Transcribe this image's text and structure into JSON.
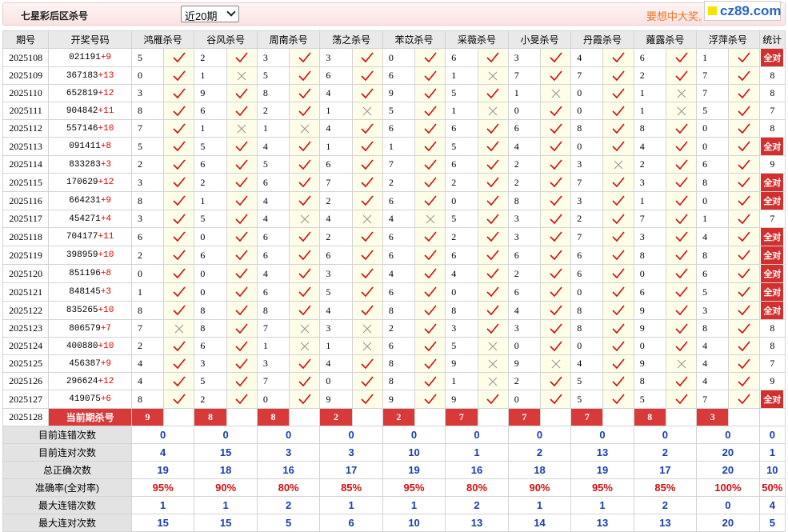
{
  "header": {
    "title": "七星彩后区杀号",
    "select_value": "近20期",
    "promo": "要想中大奖,",
    "logo": "cz89.com"
  },
  "columns": {
    "period": "期号",
    "draw": "开奖号码",
    "experts": [
      "鸿雁杀号",
      "谷风杀号",
      "周南杀号",
      "荡之杀号",
      "苯苡杀号",
      "采薇杀号",
      "小旻杀号",
      "丹霞杀号",
      "蕹露杀号",
      "浮萍杀号"
    ],
    "stat": "统计"
  },
  "full_label": "全对",
  "rows": [
    {
      "p": "2025108",
      "d": "021191",
      "b": "+9",
      "k": [
        5,
        2,
        3,
        3,
        0,
        6,
        3,
        4,
        6,
        1
      ],
      "r": [
        1,
        1,
        1,
        1,
        1,
        1,
        1,
        1,
        1,
        1
      ],
      "s": "全对"
    },
    {
      "p": "2025109",
      "d": "367183",
      "b": "+13",
      "k": [
        0,
        1,
        5,
        6,
        6,
        1,
        7,
        7,
        2,
        7
      ],
      "r": [
        1,
        0,
        1,
        1,
        1,
        0,
        1,
        1,
        1,
        1
      ],
      "s": "8"
    },
    {
      "p": "2025110",
      "d": "652819",
      "b": "+12",
      "k": [
        3,
        9,
        8,
        4,
        9,
        5,
        1,
        0,
        1,
        7
      ],
      "r": [
        1,
        1,
        1,
        1,
        1,
        1,
        0,
        1,
        0,
        1
      ],
      "s": "8"
    },
    {
      "p": "2025111",
      "d": "904842",
      "b": "+11",
      "k": [
        8,
        6,
        2,
        1,
        5,
        1,
        0,
        0,
        1,
        5
      ],
      "r": [
        1,
        1,
        1,
        0,
        1,
        0,
        1,
        1,
        0,
        1
      ],
      "s": "7"
    },
    {
      "p": "2025112",
      "d": "557146",
      "b": "+10",
      "k": [
        7,
        1,
        1,
        4,
        6,
        6,
        6,
        8,
        8,
        0
      ],
      "r": [
        1,
        0,
        0,
        1,
        1,
        1,
        1,
        1,
        1,
        1
      ],
      "s": "8"
    },
    {
      "p": "2025113",
      "d": "091411",
      "b": "+8",
      "k": [
        5,
        5,
        4,
        1,
        1,
        5,
        4,
        0,
        4,
        0
      ],
      "r": [
        1,
        1,
        1,
        1,
        1,
        1,
        1,
        1,
        1,
        1
      ],
      "s": "全对"
    },
    {
      "p": "2025114",
      "d": "833283",
      "b": "+3",
      "k": [
        2,
        6,
        5,
        6,
        7,
        6,
        2,
        3,
        2,
        6
      ],
      "r": [
        1,
        1,
        1,
        1,
        1,
        1,
        1,
        0,
        1,
        1
      ],
      "s": "9"
    },
    {
      "p": "2025115",
      "d": "170629",
      "b": "+12",
      "k": [
        3,
        2,
        6,
        7,
        2,
        2,
        2,
        7,
        3,
        8
      ],
      "r": [
        1,
        1,
        1,
        1,
        1,
        1,
        1,
        1,
        1,
        1
      ],
      "s": "全对"
    },
    {
      "p": "2025116",
      "d": "664231",
      "b": "+9",
      "k": [
        8,
        1,
        4,
        2,
        6,
        0,
        8,
        3,
        1,
        0
      ],
      "r": [
        1,
        1,
        1,
        1,
        1,
        1,
        1,
        1,
        1,
        1
      ],
      "s": "全对"
    },
    {
      "p": "2025117",
      "d": "454271",
      "b": "+4",
      "k": [
        3,
        5,
        4,
        4,
        4,
        5,
        3,
        2,
        7,
        1
      ],
      "r": [
        1,
        1,
        0,
        0,
        0,
        1,
        1,
        1,
        1,
        1
      ],
      "s": "7"
    },
    {
      "p": "2025118",
      "d": "704177",
      "b": "+11",
      "k": [
        6,
        0,
        6,
        2,
        6,
        2,
        3,
        7,
        3,
        4
      ],
      "r": [
        1,
        1,
        1,
        1,
        1,
        1,
        1,
        1,
        1,
        1
      ],
      "s": "全对"
    },
    {
      "p": "2025119",
      "d": "398959",
      "b": "+10",
      "k": [
        2,
        6,
        6,
        6,
        6,
        6,
        6,
        6,
        8,
        8
      ],
      "r": [
        1,
        1,
        1,
        1,
        1,
        1,
        1,
        1,
        1,
        1
      ],
      "s": "全对"
    },
    {
      "p": "2025120",
      "d": "851196",
      "b": "+8",
      "k": [
        0,
        0,
        4,
        3,
        4,
        4,
        2,
        6,
        0,
        6
      ],
      "r": [
        1,
        1,
        1,
        1,
        1,
        1,
        1,
        1,
        1,
        1
      ],
      "s": "全对"
    },
    {
      "p": "2025121",
      "d": "848145",
      "b": "+3",
      "k": [
        1,
        0,
        6,
        5,
        6,
        0,
        6,
        0,
        6,
        5
      ],
      "r": [
        1,
        1,
        1,
        1,
        1,
        1,
        1,
        1,
        1,
        1
      ],
      "s": "全对"
    },
    {
      "p": "2025122",
      "d": "835265",
      "b": "+10",
      "k": [
        8,
        8,
        8,
        4,
        8,
        8,
        4,
        8,
        9,
        3
      ],
      "r": [
        1,
        1,
        1,
        1,
        1,
        1,
        1,
        1,
        1,
        1
      ],
      "s": "全对"
    },
    {
      "p": "2025123",
      "d": "806579",
      "b": "+7",
      "k": [
        7,
        8,
        7,
        3,
        2,
        3,
        3,
        8,
        9,
        8
      ],
      "r": [
        0,
        1,
        0,
        0,
        1,
        1,
        1,
        1,
        1,
        1
      ],
      "s": "8"
    },
    {
      "p": "2025124",
      "d": "400880",
      "b": "+10",
      "k": [
        2,
        6,
        1,
        1,
        6,
        5,
        0,
        0,
        0,
        4
      ],
      "r": [
        1,
        1,
        0,
        0,
        1,
        0,
        1,
        1,
        1,
        1
      ],
      "s": "8"
    },
    {
      "p": "2025125",
      "d": "456387",
      "b": "+9",
      "k": [
        4,
        3,
        3,
        4,
        8,
        9,
        9,
        4,
        9,
        4
      ],
      "r": [
        1,
        1,
        1,
        1,
        1,
        0,
        0,
        1,
        0,
        1
      ],
      "s": "7"
    },
    {
      "p": "2025126",
      "d": "296624",
      "b": "+12",
      "k": [
        4,
        5,
        7,
        0,
        8,
        1,
        2,
        5,
        8,
        4
      ],
      "r": [
        1,
        1,
        1,
        1,
        1,
        0,
        1,
        1,
        1,
        1
      ],
      "s": "9"
    },
    {
      "p": "2025127",
      "d": "419075",
      "b": "+6",
      "k": [
        8,
        2,
        0,
        9,
        9,
        9,
        0,
        5,
        5,
        7
      ],
      "r": [
        1,
        1,
        1,
        1,
        1,
        1,
        1,
        1,
        1,
        1
      ],
      "s": "全对"
    }
  ],
  "current": {
    "p": "2025128",
    "label": "当前期杀号",
    "k": [
      9,
      8,
      8,
      2,
      2,
      7,
      7,
      7,
      8,
      3
    ]
  },
  "stats": [
    {
      "label": "目前连错次数",
      "v": [
        "0",
        "0",
        "0",
        "0",
        "0",
        "0",
        "0",
        "0",
        "0",
        "0",
        "0"
      ],
      "red": false
    },
    {
      "label": "目前连对次数",
      "v": [
        "4",
        "15",
        "3",
        "3",
        "10",
        "1",
        "2",
        "13",
        "2",
        "20",
        "1"
      ],
      "red": false
    },
    {
      "label": "总正确次数",
      "v": [
        "19",
        "18",
        "16",
        "17",
        "19",
        "16",
        "18",
        "19",
        "17",
        "20",
        "10"
      ],
      "red": false
    },
    {
      "label": "准确率(全对率)",
      "v": [
        "95%",
        "90%",
        "80%",
        "85%",
        "95%",
        "80%",
        "90%",
        "95%",
        "85%",
        "100%",
        "50%"
      ],
      "red": true
    },
    {
      "label": "最大连错次数",
      "v": [
        "1",
        "1",
        "2",
        "1",
        "1",
        "2",
        "1",
        "1",
        "2",
        "0",
        "4"
      ],
      "red": false
    },
    {
      "label": "最大连对次数",
      "v": [
        "15",
        "15",
        "5",
        "6",
        "10",
        "13",
        "14",
        "13",
        "13",
        "20",
        "5"
      ],
      "red": false
    }
  ],
  "colors": {
    "check": "#d01010",
    "cross": "#999999",
    "full": "#d32f2f"
  }
}
